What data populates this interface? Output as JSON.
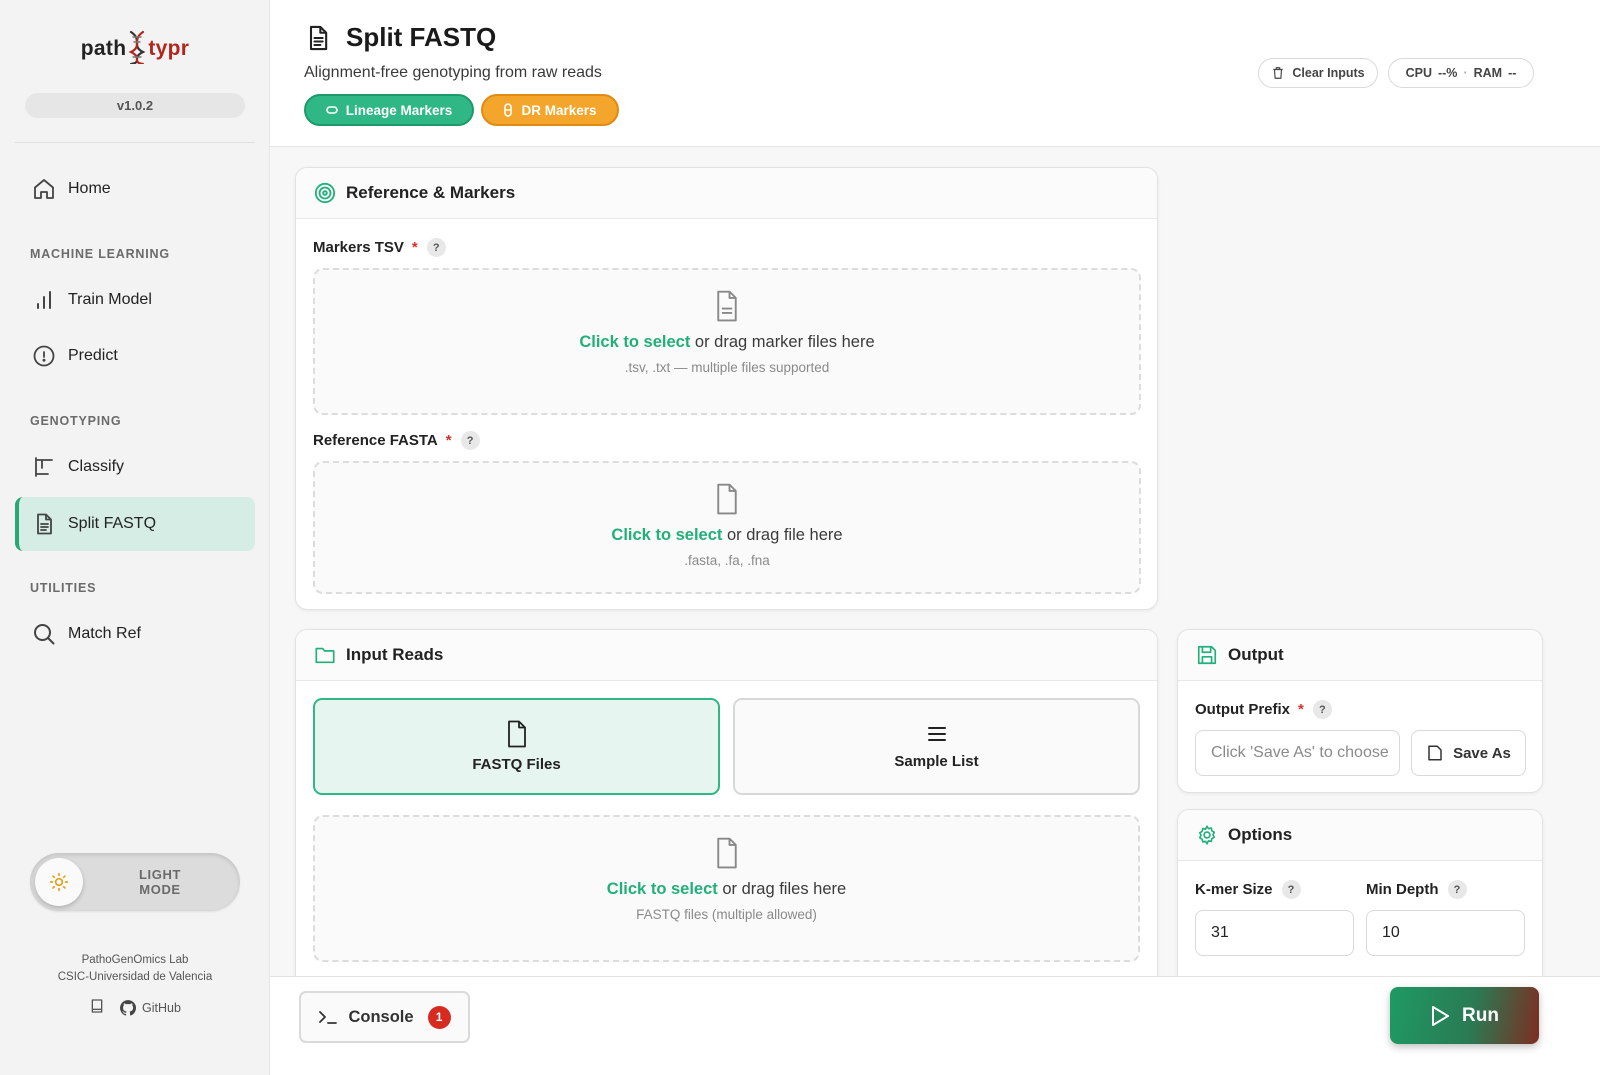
{
  "app": {
    "logo_part1": "path",
    "logo_part2": "typr",
    "version": "v1.0.2",
    "lab_line1": "PathoGenOmics Lab",
    "lab_line2": "CSIC-Universidad de Valencia",
    "github_label": "GitHub",
    "theme_label_line1": "LIGHT",
    "theme_label_line2": "MODE"
  },
  "sidebar": {
    "home": "Home",
    "section_ml": "MACHINE LEARNING",
    "train": "Train Model",
    "predict": "Predict",
    "section_geno": "GENOTYPING",
    "classify": "Classify",
    "split": "Split FASTQ",
    "section_util": "UTILITIES",
    "match": "Match Ref"
  },
  "header": {
    "title": "Split FASTQ",
    "subtitle": "Alignment-free genotyping from raw reads",
    "lineage_badge": "Lineage Markers",
    "dr_badge": "DR Markers",
    "clear_label": "Clear Inputs",
    "cpu_label": "CPU",
    "cpu_value": "--%",
    "ram_label": "RAM",
    "ram_value": "--"
  },
  "reference": {
    "title": "Reference & Markers",
    "markers_label": "Markers TSV",
    "markers_drop_link": "Click to select",
    "markers_drop_text": "or drag marker files here",
    "markers_drop_hint": ".tsv, .txt — multiple files supported",
    "fasta_label": "Reference FASTA",
    "fasta_drop_link": "Click to select",
    "fasta_drop_text": "or drag file here",
    "fasta_drop_hint": ".fasta, .fa, .fna"
  },
  "input_reads": {
    "title": "Input Reads",
    "fastq_option": "FASTQ Files",
    "sample_option": "Sample List",
    "drop_link": "Click to select",
    "drop_text": "or drag files here",
    "drop_hint": "FASTQ files (multiple allowed)"
  },
  "output": {
    "title": "Output",
    "prefix_label": "Output Prefix",
    "prefix_placeholder": "Click 'Save As' to choose",
    "save_as": "Save As"
  },
  "options": {
    "title": "Options",
    "kmer_label": "K-mer Size",
    "kmer_value": "31",
    "mindepth_label": "Min Depth",
    "mindepth_value": "10"
  },
  "bottom": {
    "console_label": "Console",
    "console_count": "1",
    "run_label": "Run"
  },
  "colors": {
    "accent_green": "#22b07a",
    "badge_green": "#2fb885",
    "badge_orange": "#f3a52c",
    "required_red": "#d93025"
  }
}
